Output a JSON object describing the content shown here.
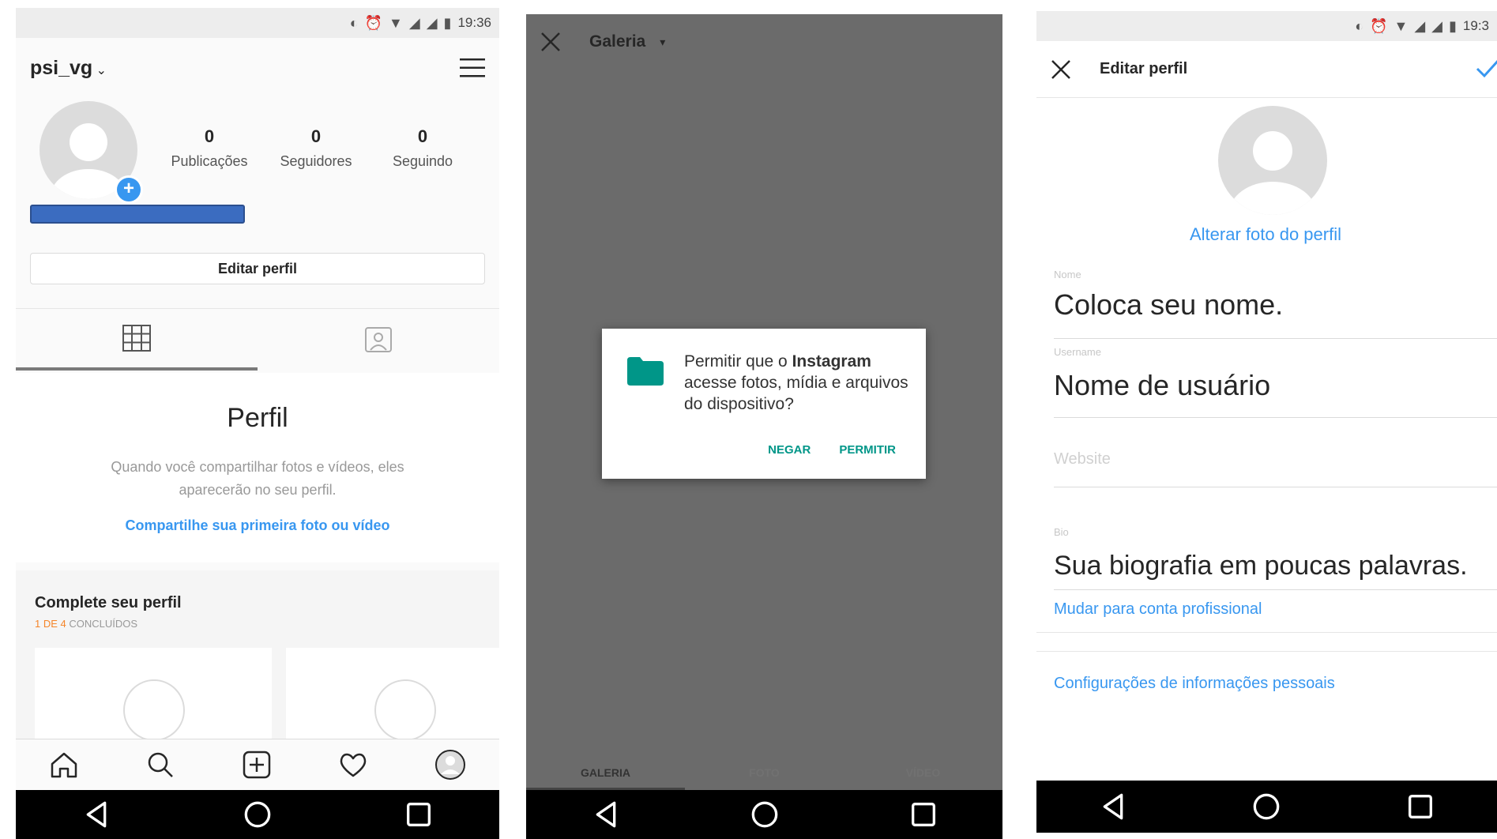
{
  "status_bar": {
    "time_left": "19:36",
    "time_right": "19:3"
  },
  "profile_screen": {
    "username": "psi_vg",
    "stats": [
      {
        "value": "0",
        "label": "Publicações"
      },
      {
        "value": "0",
        "label": "Seguidores"
      },
      {
        "value": "0",
        "label": "Seguindo"
      }
    ],
    "edit_profile_label": "Editar perfil",
    "empty_title": "Perfil",
    "empty_description": "Quando você compartilhar fotos e vídeos, eles aparecerão no seu perfil.",
    "share_first_link": "Compartilhe sua primeira foto ou vídeo",
    "complete_title": "Complete seu perfil",
    "complete_progress": "1 DE 4",
    "complete_suffix": "CONCLUÍDOS"
  },
  "gallery_screen": {
    "title": "Galeria",
    "dialog": {
      "text_before": "Permitir que o ",
      "text_bold": "Instagram",
      "text_after": " acesse fotos, mídia e arquivos do dispositivo?",
      "deny": "NEGAR",
      "allow": "PERMITIR"
    },
    "tabs": [
      "GALERIA",
      "FOTO",
      "VÍDEO"
    ]
  },
  "edit_screen": {
    "title": "Editar perfil",
    "change_photo": "Alterar foto do perfil",
    "name_label": "Nome",
    "name_value": "Coloca seu nome.",
    "username_label": "Username",
    "username_value": "Nome de usuário",
    "website_placeholder": "Website",
    "bio_label": "Bio",
    "bio_value": "Sua biografia em poucas palavras.",
    "switch_professional": "Mudar para conta profissional",
    "personal_info": "Configurações de informações pessoais"
  },
  "colors": {
    "accent_blue": "#3897f0",
    "dialog_green": "#009688",
    "orange": "#f58529"
  }
}
